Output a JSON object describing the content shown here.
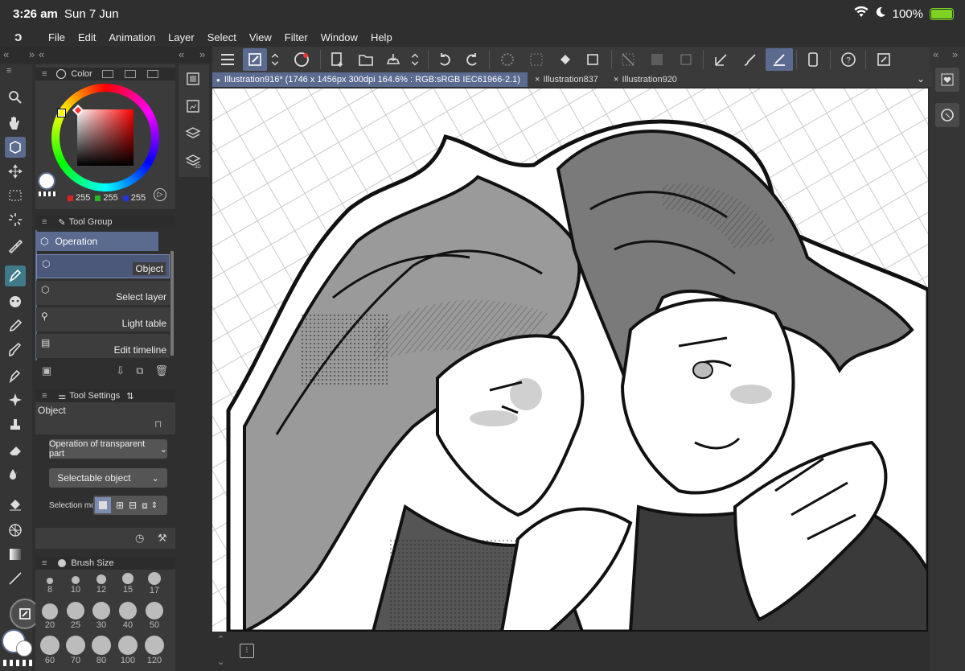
{
  "status": {
    "time": "3:26 am",
    "date": "Sun 7 Jun",
    "battery": "100%"
  },
  "menu": [
    "File",
    "Edit",
    "Animation",
    "Layer",
    "Select",
    "View",
    "Filter",
    "Window",
    "Help"
  ],
  "color_panel": {
    "title": "Color",
    "r": "255",
    "g": "255",
    "b": "255",
    "accent": "#5b6a8f"
  },
  "tool_group": {
    "title": "Tool Group",
    "group": "Operation",
    "items": [
      "Object",
      "Select layer",
      "Light table",
      "Edit timeline"
    ]
  },
  "tool_settings": {
    "title": "Tool Settings",
    "subtool": "Object",
    "transparent_mode": "Operation of transparent part",
    "selectable": "Selectable object",
    "selection_mode_label": "Selection mo"
  },
  "brush_size": {
    "title": "Brush Size",
    "sizes": [
      "8",
      "10",
      "12",
      "15",
      "17",
      "20",
      "25",
      "30",
      "40",
      "50",
      "60",
      "70",
      "80",
      "100",
      "120"
    ]
  },
  "tabs": [
    {
      "label": "Illustration916* (1746 x 1456px 300dpi 164.6% : RGB:sRGB IEC61966-2.1)",
      "active": true
    },
    {
      "label": "Illustration837",
      "active": false
    },
    {
      "label": "Illustration920",
      "active": false
    }
  ],
  "icons": [
    "menu-icon",
    "object-tool-icon",
    "undo-icon",
    "redo-icon",
    "new-icon",
    "open-icon",
    "save-icon",
    "help-icon"
  ]
}
